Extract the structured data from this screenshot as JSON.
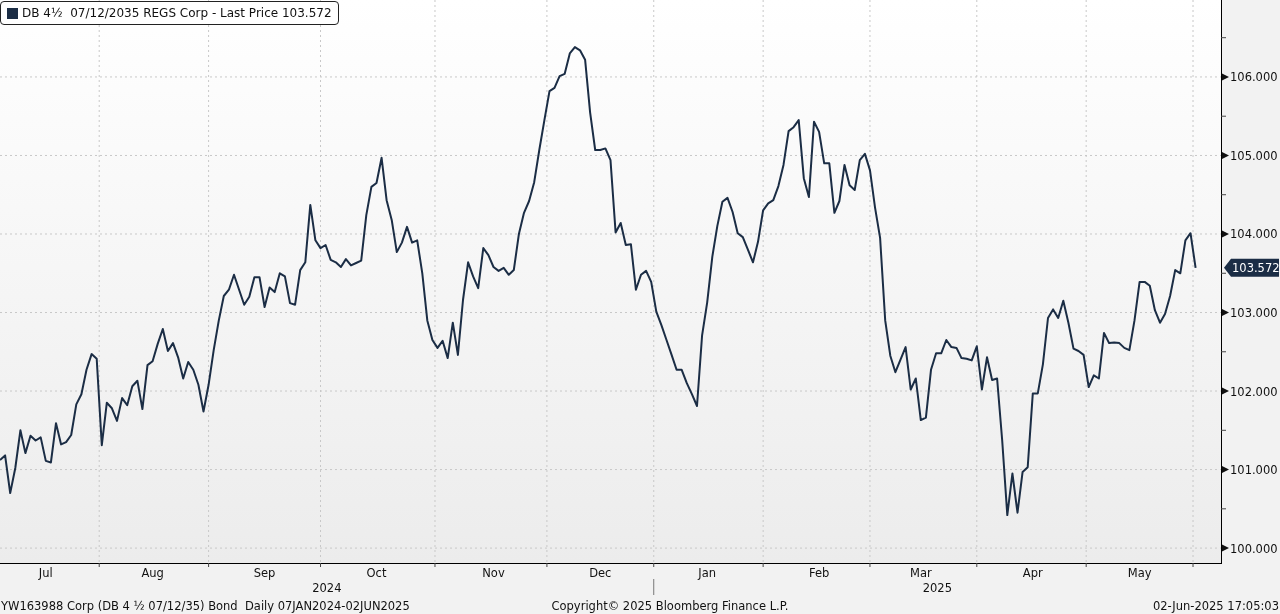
{
  "chart": {
    "chart_data": {
      "type": "line",
      "grid": true,
      "ylim": [
        99.81,
        106.98
      ],
      "yticks": [
        {
          "value": 100,
          "label": "100.000"
        },
        {
          "value": 101,
          "label": "101.000"
        },
        {
          "value": 102,
          "label": "102.000"
        },
        {
          "value": 103,
          "label": "103.000"
        },
        {
          "value": 104,
          "label": "104.000"
        },
        {
          "value": 105,
          "label": "105.000"
        },
        {
          "value": 106,
          "label": "106.000"
        }
      ],
      "categories": [
        null,
        null,
        null,
        null,
        null,
        null,
        null,
        null,
        null,
        "Jul",
        null,
        null,
        null,
        null,
        null,
        null,
        null,
        null,
        null,
        null,
        null,
        null,
        null,
        null,
        null,
        null,
        null,
        null,
        null,
        null,
        "Aug",
        null,
        null,
        null,
        null,
        null,
        null,
        null,
        null,
        null,
        null,
        null,
        null,
        null,
        null,
        null,
        null,
        null,
        null,
        null,
        null,
        null,
        "Sep",
        null,
        null,
        null,
        null,
        null,
        null,
        null,
        null,
        null,
        null,
        null,
        null,
        null,
        null,
        null,
        null,
        null,
        null,
        null,
        null,
        null,
        "Oct",
        null,
        null,
        null,
        null,
        null,
        null,
        null,
        null,
        null,
        null,
        null,
        null,
        null,
        null,
        null,
        null,
        null,
        null,
        null,
        null,
        null,
        null,
        "Nov",
        null,
        null,
        null,
        null,
        null,
        null,
        null,
        null,
        null,
        null,
        null,
        null,
        null,
        null,
        null,
        null,
        null,
        null,
        null,
        null,
        "Dec",
        null,
        null,
        null,
        null,
        null,
        null,
        null,
        null,
        null,
        null,
        null,
        null,
        null,
        null,
        null,
        null,
        null,
        null,
        null,
        null,
        "Jan",
        null,
        null,
        null,
        null,
        null,
        null,
        null,
        null,
        null,
        null,
        null,
        null,
        null,
        null,
        null,
        null,
        null,
        null,
        null,
        null,
        null,
        "Feb",
        null,
        null,
        null,
        null,
        null,
        null,
        null,
        null,
        null,
        null,
        null,
        null,
        null,
        null,
        null,
        null,
        null,
        null,
        null,
        "Mar",
        null,
        null,
        null,
        null,
        null,
        null,
        null,
        null,
        null,
        null,
        null,
        null,
        null,
        null,
        null,
        null,
        null,
        null,
        null,
        null,
        null,
        "Apr",
        null,
        null,
        null,
        null,
        null,
        null,
        null,
        null,
        null,
        null,
        null,
        null,
        null,
        null,
        null,
        null,
        null,
        null,
        null,
        null,
        "May",
        null,
        null,
        null,
        null,
        null,
        null,
        null,
        null,
        null,
        null,
        null
      ],
      "series": [
        {
          "name": "DB 4½  07/12/2035 REGS Corp - Last Price 103.572",
          "color": "#1b2d45",
          "values": [
            101.12,
            101.18,
            100.7,
            101.02,
            101.5,
            101.21,
            101.43,
            101.37,
            101.41,
            101.11,
            101.09,
            101.59,
            101.32,
            101.35,
            101.44,
            101.83,
            101.96,
            102.27,
            102.47,
            102.41,
            101.31,
            101.85,
            101.78,
            101.62,
            101.91,
            101.82,
            102.06,
            102.13,
            101.77,
            102.33,
            102.38,
            102.6,
            102.79,
            102.51,
            102.61,
            102.43,
            102.16,
            102.37,
            102.27,
            102.08,
            101.74,
            102.08,
            102.52,
            102.9,
            103.21,
            103.29,
            103.48,
            103.29,
            103.1,
            103.2,
            103.45,
            103.45,
            103.07,
            103.32,
            103.26,
            103.5,
            103.46,
            103.12,
            103.1,
            103.54,
            103.64,
            104.37,
            103.92,
            103.82,
            103.86,
            103.67,
            103.64,
            103.58,
            103.68,
            103.6,
            103.63,
            103.66,
            104.24,
            104.6,
            104.65,
            104.97,
            104.43,
            104.18,
            103.77,
            103.89,
            104.09,
            103.89,
            103.92,
            103.5,
            102.9,
            102.65,
            102.55,
            102.64,
            102.42,
            102.87,
            102.46,
            103.16,
            103.64,
            103.46,
            103.31,
            103.82,
            103.73,
            103.58,
            103.53,
            103.57,
            103.48,
            103.54,
            104.0,
            104.27,
            104.42,
            104.66,
            105.07,
            105.45,
            105.82,
            105.86,
            106.01,
            106.04,
            106.3,
            106.38,
            106.34,
            106.22,
            105.55,
            105.07,
            105.07,
            105.09,
            104.94,
            104.02,
            104.14,
            103.86,
            103.87,
            103.29,
            103.48,
            103.53,
            103.39,
            103.01,
            102.84,
            102.65,
            102.46,
            102.27,
            102.27,
            102.1,
            101.96,
            101.81,
            102.71,
            103.13,
            103.71,
            104.1,
            104.41,
            104.46,
            104.28,
            104.01,
            103.96,
            103.8,
            103.64,
            103.9,
            104.3,
            104.39,
            104.43,
            104.61,
            104.88,
            105.31,
            105.36,
            105.45,
            104.71,
            104.47,
            105.43,
            105.3,
            104.9,
            104.9,
            104.27,
            104.42,
            104.88,
            104.62,
            104.56,
            104.94,
            105.02,
            104.81,
            104.34,
            103.95,
            102.9,
            102.45,
            102.24,
            102.4,
            102.56,
            102.02,
            102.16,
            101.63,
            101.66,
            102.27,
            102.48,
            102.48,
            102.65,
            102.56,
            102.55,
            102.42,
            102.41,
            102.39,
            102.57,
            102.02,
            102.43,
            102.14,
            102.16,
            101.37,
            100.42,
            100.95,
            100.45,
            100.97,
            101.03,
            101.97,
            101.97,
            102.34,
            102.93,
            103.04,
            102.93,
            103.15,
            102.87,
            102.54,
            102.51,
            102.46,
            102.05,
            102.2,
            102.16,
            102.74,
            102.61,
            102.62,
            102.61,
            102.55,
            102.52,
            102.9,
            103.39,
            103.39,
            103.34,
            103.03,
            102.87,
            102.98,
            103.21,
            103.54,
            103.5,
            103.92,
            104.01,
            103.57
          ]
        }
      ]
    },
    "last_price_tag": "103.572",
    "x_axis_years": [
      "2024",
      "2025"
    ]
  },
  "footer": {
    "security": "YW163988 Corp (DB 4 ½ 07/12/35) Bond  Daily 07JAN2024-02JUN2025",
    "copyright": "Copyright© 2025 Bloomberg Finance L.P.",
    "timestamp": "02-Jun-2025 17:05:03"
  }
}
